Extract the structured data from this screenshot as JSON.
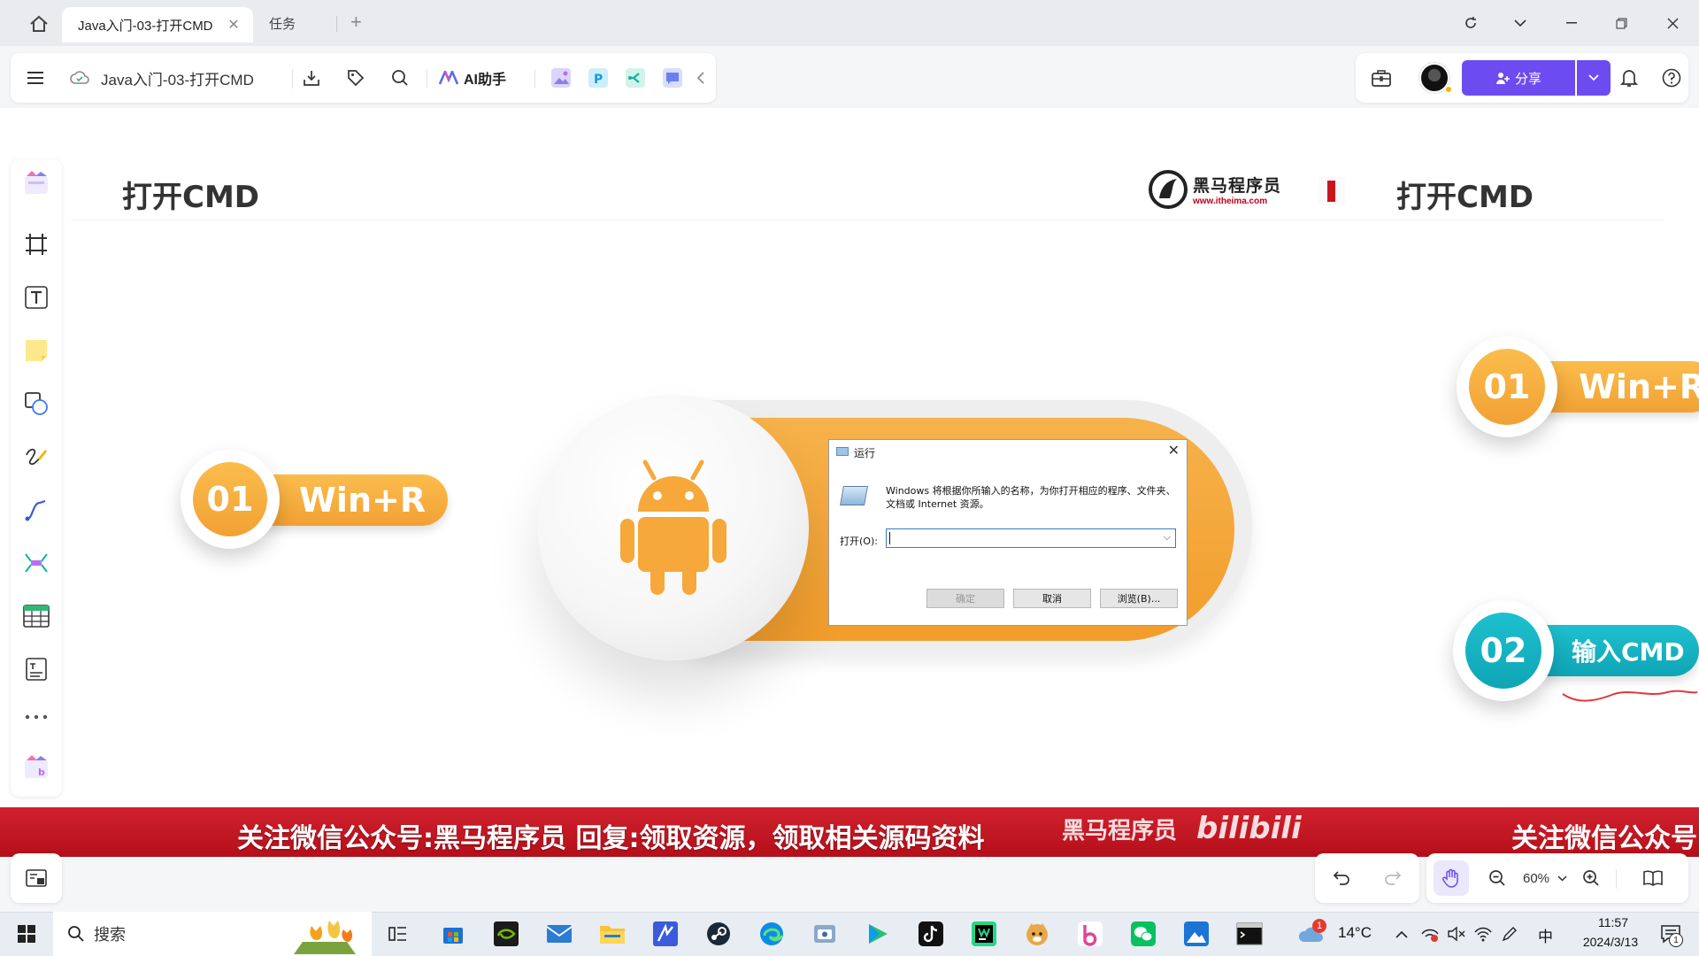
{
  "browser": {
    "tab_active_title": "Java入门-03-打开CMD",
    "tab_second_title": "任务"
  },
  "toolbar": {
    "doc_title": "Java入门-03-打开CMD",
    "ai_label": "AI助手",
    "share_label": "分享"
  },
  "slide": {
    "title_left": "打开CMD",
    "title_right": "打开CMD",
    "logo_cn": "黑马程序员",
    "logo_url": "www.itheima.com",
    "step1_num": "01",
    "step1_label": "Win+R",
    "step1b_num": "01",
    "step1b_label": "Win+R",
    "step2_num": "02",
    "step2_label": "输入CMD"
  },
  "run_dialog": {
    "title": "运行",
    "description": "Windows 将根据你所输入的名称，为你打开相应的程序、文件夹、文档或 Internet 资源。",
    "open_label": "打开(O):",
    "ok": "确定",
    "cancel": "取消",
    "browse": "浏览(B)..."
  },
  "banner": {
    "text": "关注微信公众号:黑马程序员  回复:领取资源，领取相关源码资料",
    "brand": "黑马程序员",
    "bili": "bilibili",
    "text_right": "关注微信公众号"
  },
  "zoom": {
    "value": "60%"
  },
  "taskbar": {
    "search_label": "搜索",
    "weather": "14°C",
    "ime": "中",
    "time": "11:57",
    "date": "2024/3/13",
    "notification_count": "1",
    "weather_badge": "1"
  },
  "colors": {
    "accent_purple": "#6c4cf0",
    "step_orange": "#f2a133",
    "step_teal": "#0fa5b5",
    "banner_red": "#c8161d"
  }
}
